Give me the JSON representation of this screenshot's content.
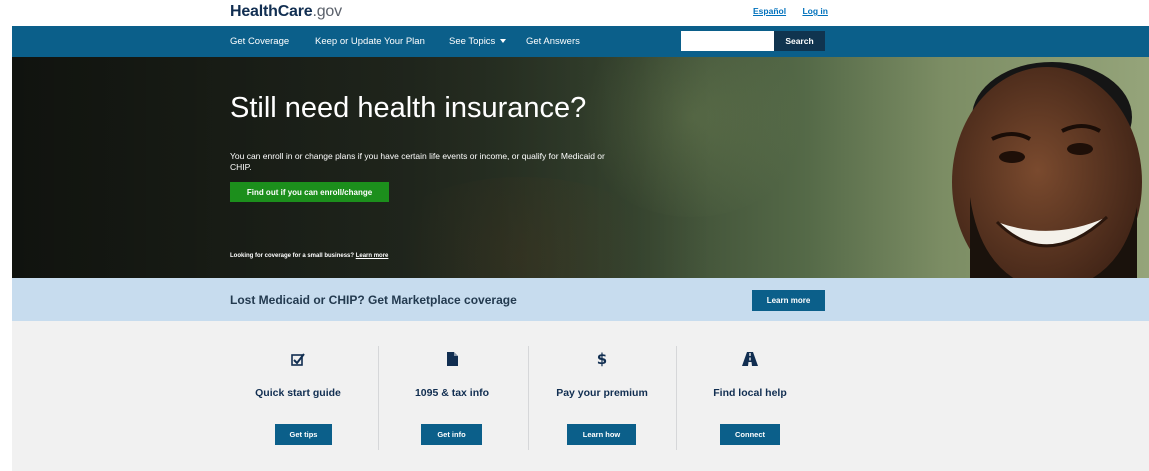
{
  "header": {
    "logo_health": "HealthCare",
    "logo_gov": ".gov",
    "link_spanish": "Español",
    "link_login": "Log in"
  },
  "nav": {
    "items": [
      "Get Coverage",
      "Keep or Update Your Plan",
      "See Topics",
      "Get Answers"
    ],
    "search_placeholder": "",
    "search_button": "Search"
  },
  "hero": {
    "title": "Still need health insurance?",
    "text": "You can enroll in or change plans if you have certain life events or income, or qualify for Medicaid or CHIP.",
    "button": "Find out if you can enroll/change",
    "small_text": "Looking for coverage for a small business?",
    "small_link": "Learn more"
  },
  "banner": {
    "text": "Lost Medicaid or CHIP? Get Marketplace coverage",
    "button": "Learn more"
  },
  "cards": [
    {
      "icon": "checklist-icon",
      "title": "Quick start guide",
      "button": "Get tips"
    },
    {
      "icon": "document-icon",
      "title": "1095 & tax info",
      "button": "Get info"
    },
    {
      "icon": "dollar-icon",
      "title": "Pay your premium",
      "button": "Learn how"
    },
    {
      "icon": "road-icon",
      "title": "Find local help",
      "button": "Connect"
    }
  ],
  "colors": {
    "nav_blue": "#0b5f8a",
    "button_green": "#1c8f1c",
    "banner_bg": "#c7dcee",
    "cards_bg": "#f1f1f1"
  }
}
